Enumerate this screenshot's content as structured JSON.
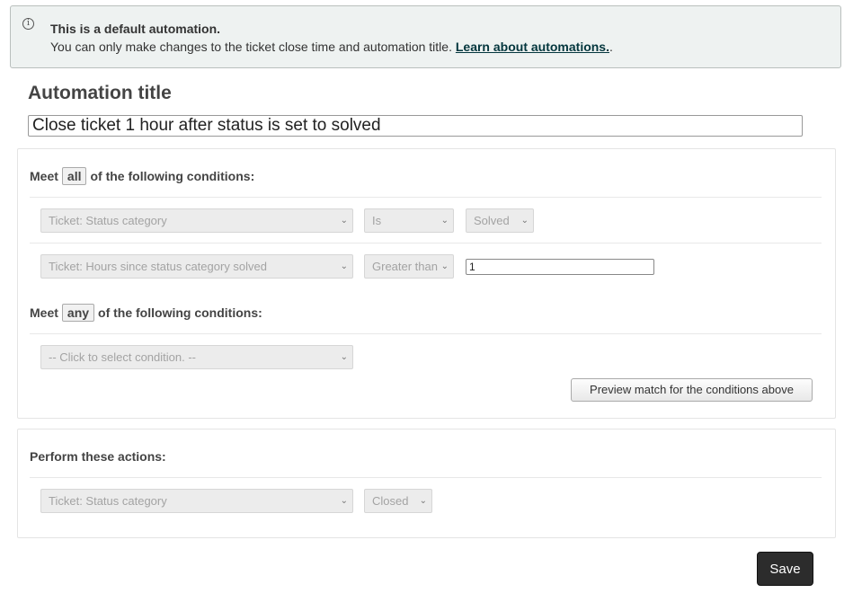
{
  "notice": {
    "title": "This is a default automation.",
    "body": "You can only make changes to the ticket close time and automation title. ",
    "link": "Learn about automations.",
    "link_suffix": "."
  },
  "automation_title": {
    "heading": "Automation title",
    "value": "Close ticket 1 hour after status is set to solved"
  },
  "conditions_all": {
    "prefix": "Meet",
    "keyword": "all",
    "suffix": "of the following conditions:",
    "rows": [
      {
        "field": "Ticket: Status category",
        "operator": "Is",
        "value": "Solved"
      },
      {
        "field": "Ticket: Hours since status category solved",
        "operator": "Greater than",
        "value": "1"
      }
    ]
  },
  "conditions_any": {
    "prefix": "Meet",
    "keyword": "any",
    "suffix": "of the following conditions:",
    "placeholder": "-- Click to select condition. --"
  },
  "preview_button": "Preview match for the conditions above",
  "actions": {
    "heading": "Perform these actions:",
    "field": "Ticket: Status category",
    "value": "Closed"
  },
  "save_button": "Save",
  "icons": {
    "info": "info-icon",
    "chevron": "chevron-down-icon"
  }
}
